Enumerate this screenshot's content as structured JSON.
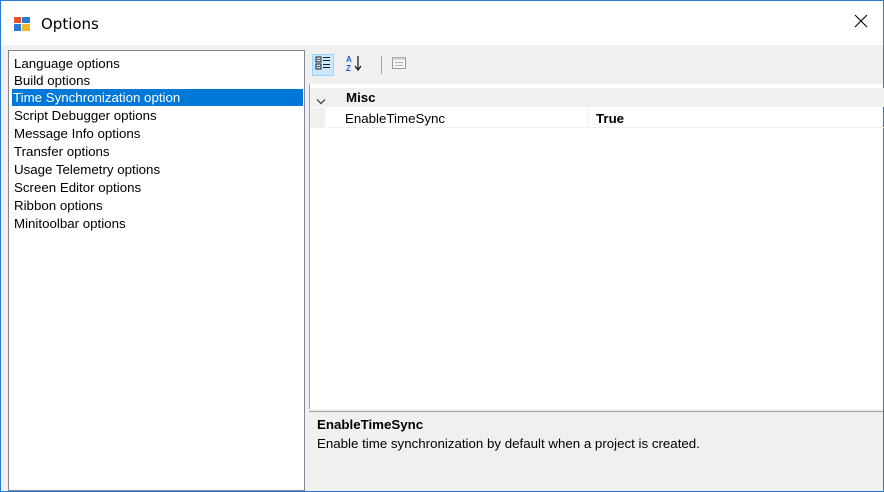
{
  "window": {
    "title": "Options",
    "icon": "options-app-icon",
    "close_icon": "close-icon"
  },
  "categories": [
    {
      "label": "Language options",
      "selected": false
    },
    {
      "label": "Build options",
      "selected": false
    },
    {
      "label": "Time Synchronization option",
      "selected": true
    },
    {
      "label": "Script Debugger options",
      "selected": false
    },
    {
      "label": "Message Info options",
      "selected": false
    },
    {
      "label": "Transfer options",
      "selected": false
    },
    {
      "label": "Usage Telemetry options",
      "selected": false
    },
    {
      "label": "Screen Editor options",
      "selected": false
    },
    {
      "label": "Ribbon options",
      "selected": false
    },
    {
      "label": "Minitoolbar options",
      "selected": false
    }
  ],
  "toolbar": {
    "categorized_icon": "categorized-view-icon",
    "alphabetical_icon": "alphabetical-sort-icon",
    "property_pages_icon": "property-pages-icon"
  },
  "grid": {
    "category": "Misc",
    "properties": [
      {
        "name": "EnableTimeSync",
        "value": "True"
      }
    ]
  },
  "description": {
    "title": "EnableTimeSync",
    "text": "Enable time synchronization by default when a project is created."
  },
  "colors": {
    "selection": "#0078d7",
    "border": "#2b79d7"
  }
}
